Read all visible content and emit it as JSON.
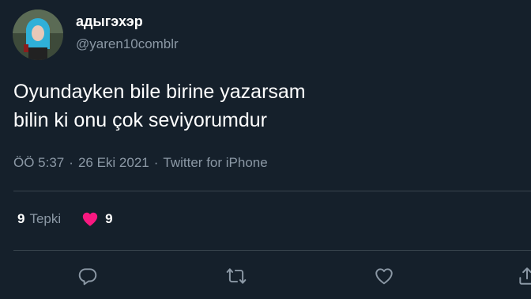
{
  "user": {
    "display_name": "адыгэхэр",
    "handle": "@yaren10comblr"
  },
  "tweet": {
    "lines": [
      "Oyundayken bile birine yazarsam",
      "bilin ki onu çok seviyorumdur"
    ],
    "time": "ÖÖ 5:37",
    "date": "26 Eki 2021",
    "source": "Twitter for iPhone",
    "separator": "·"
  },
  "stats": {
    "reaction_count": "9",
    "reaction_label": "Tepki",
    "like_count": "9"
  },
  "colors": {
    "background": "#15202b",
    "secondary_text": "#8b98a5",
    "like_pink": "#f91880",
    "divider": "#38444d"
  },
  "icons": {
    "reply": "reply-icon",
    "retweet": "retweet-icon",
    "like": "like-icon",
    "share": "share-icon",
    "like_stat": "heart-filled-icon"
  }
}
